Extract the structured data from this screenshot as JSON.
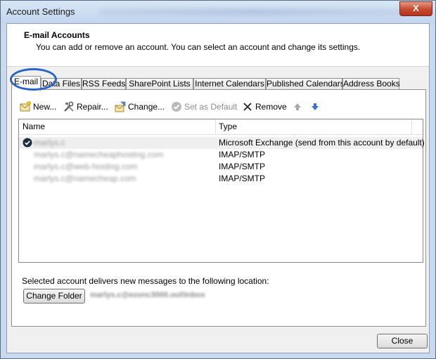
{
  "window": {
    "title": "Account Settings",
    "close_label": "X"
  },
  "header": {
    "title": "E-mail Accounts",
    "subtitle": "You can add or remove an account. You can select an account and change its settings."
  },
  "tabs": [
    {
      "label": "E-mail",
      "active": true
    },
    {
      "label": "Data Files"
    },
    {
      "label": "RSS Feeds"
    },
    {
      "label": "SharePoint Lists"
    },
    {
      "label": "Internet Calendars"
    },
    {
      "label": "Published Calendars"
    },
    {
      "label": "Address Books"
    }
  ],
  "toolbar": {
    "new": {
      "label": "New...",
      "icon": "new-account-icon"
    },
    "repair": {
      "label": "Repair...",
      "icon": "repair-tools-icon"
    },
    "change": {
      "label": "Change...",
      "icon": "change-account-icon"
    },
    "set_default": {
      "label": "Set as Default",
      "icon": "checkmark-circle-icon",
      "enabled": false
    },
    "remove": {
      "label": "Remove",
      "icon": "remove-x-icon"
    },
    "move_up": {
      "icon": "arrow-up-icon"
    },
    "move_down": {
      "icon": "arrow-down-icon"
    }
  },
  "list": {
    "columns": [
      "Name",
      "Type"
    ],
    "rows": [
      {
        "name": "marlys.c",
        "type": "Microsoft Exchange (send from this account by default)",
        "default": true,
        "selected": true
      },
      {
        "name": "marlys.c@namecheaphosting.com",
        "type": "IMAP/SMTP"
      },
      {
        "name": "marlys.c@web-hosting.com",
        "type": "IMAP/SMTP"
      },
      {
        "name": "marlys.c@namecheap.com",
        "type": "IMAP/SMTP"
      }
    ]
  },
  "delivery": {
    "label": "Selected account delivers new messages to the following location:",
    "change_folder_label": "Change Folder",
    "folder_path": "marlys.c@ezonc3000.out\\Inbox"
  },
  "footer": {
    "close_label": "Close"
  },
  "colors": {
    "highlight_circle": "#2a63c9",
    "window_frame": "#c9d9ee"
  }
}
